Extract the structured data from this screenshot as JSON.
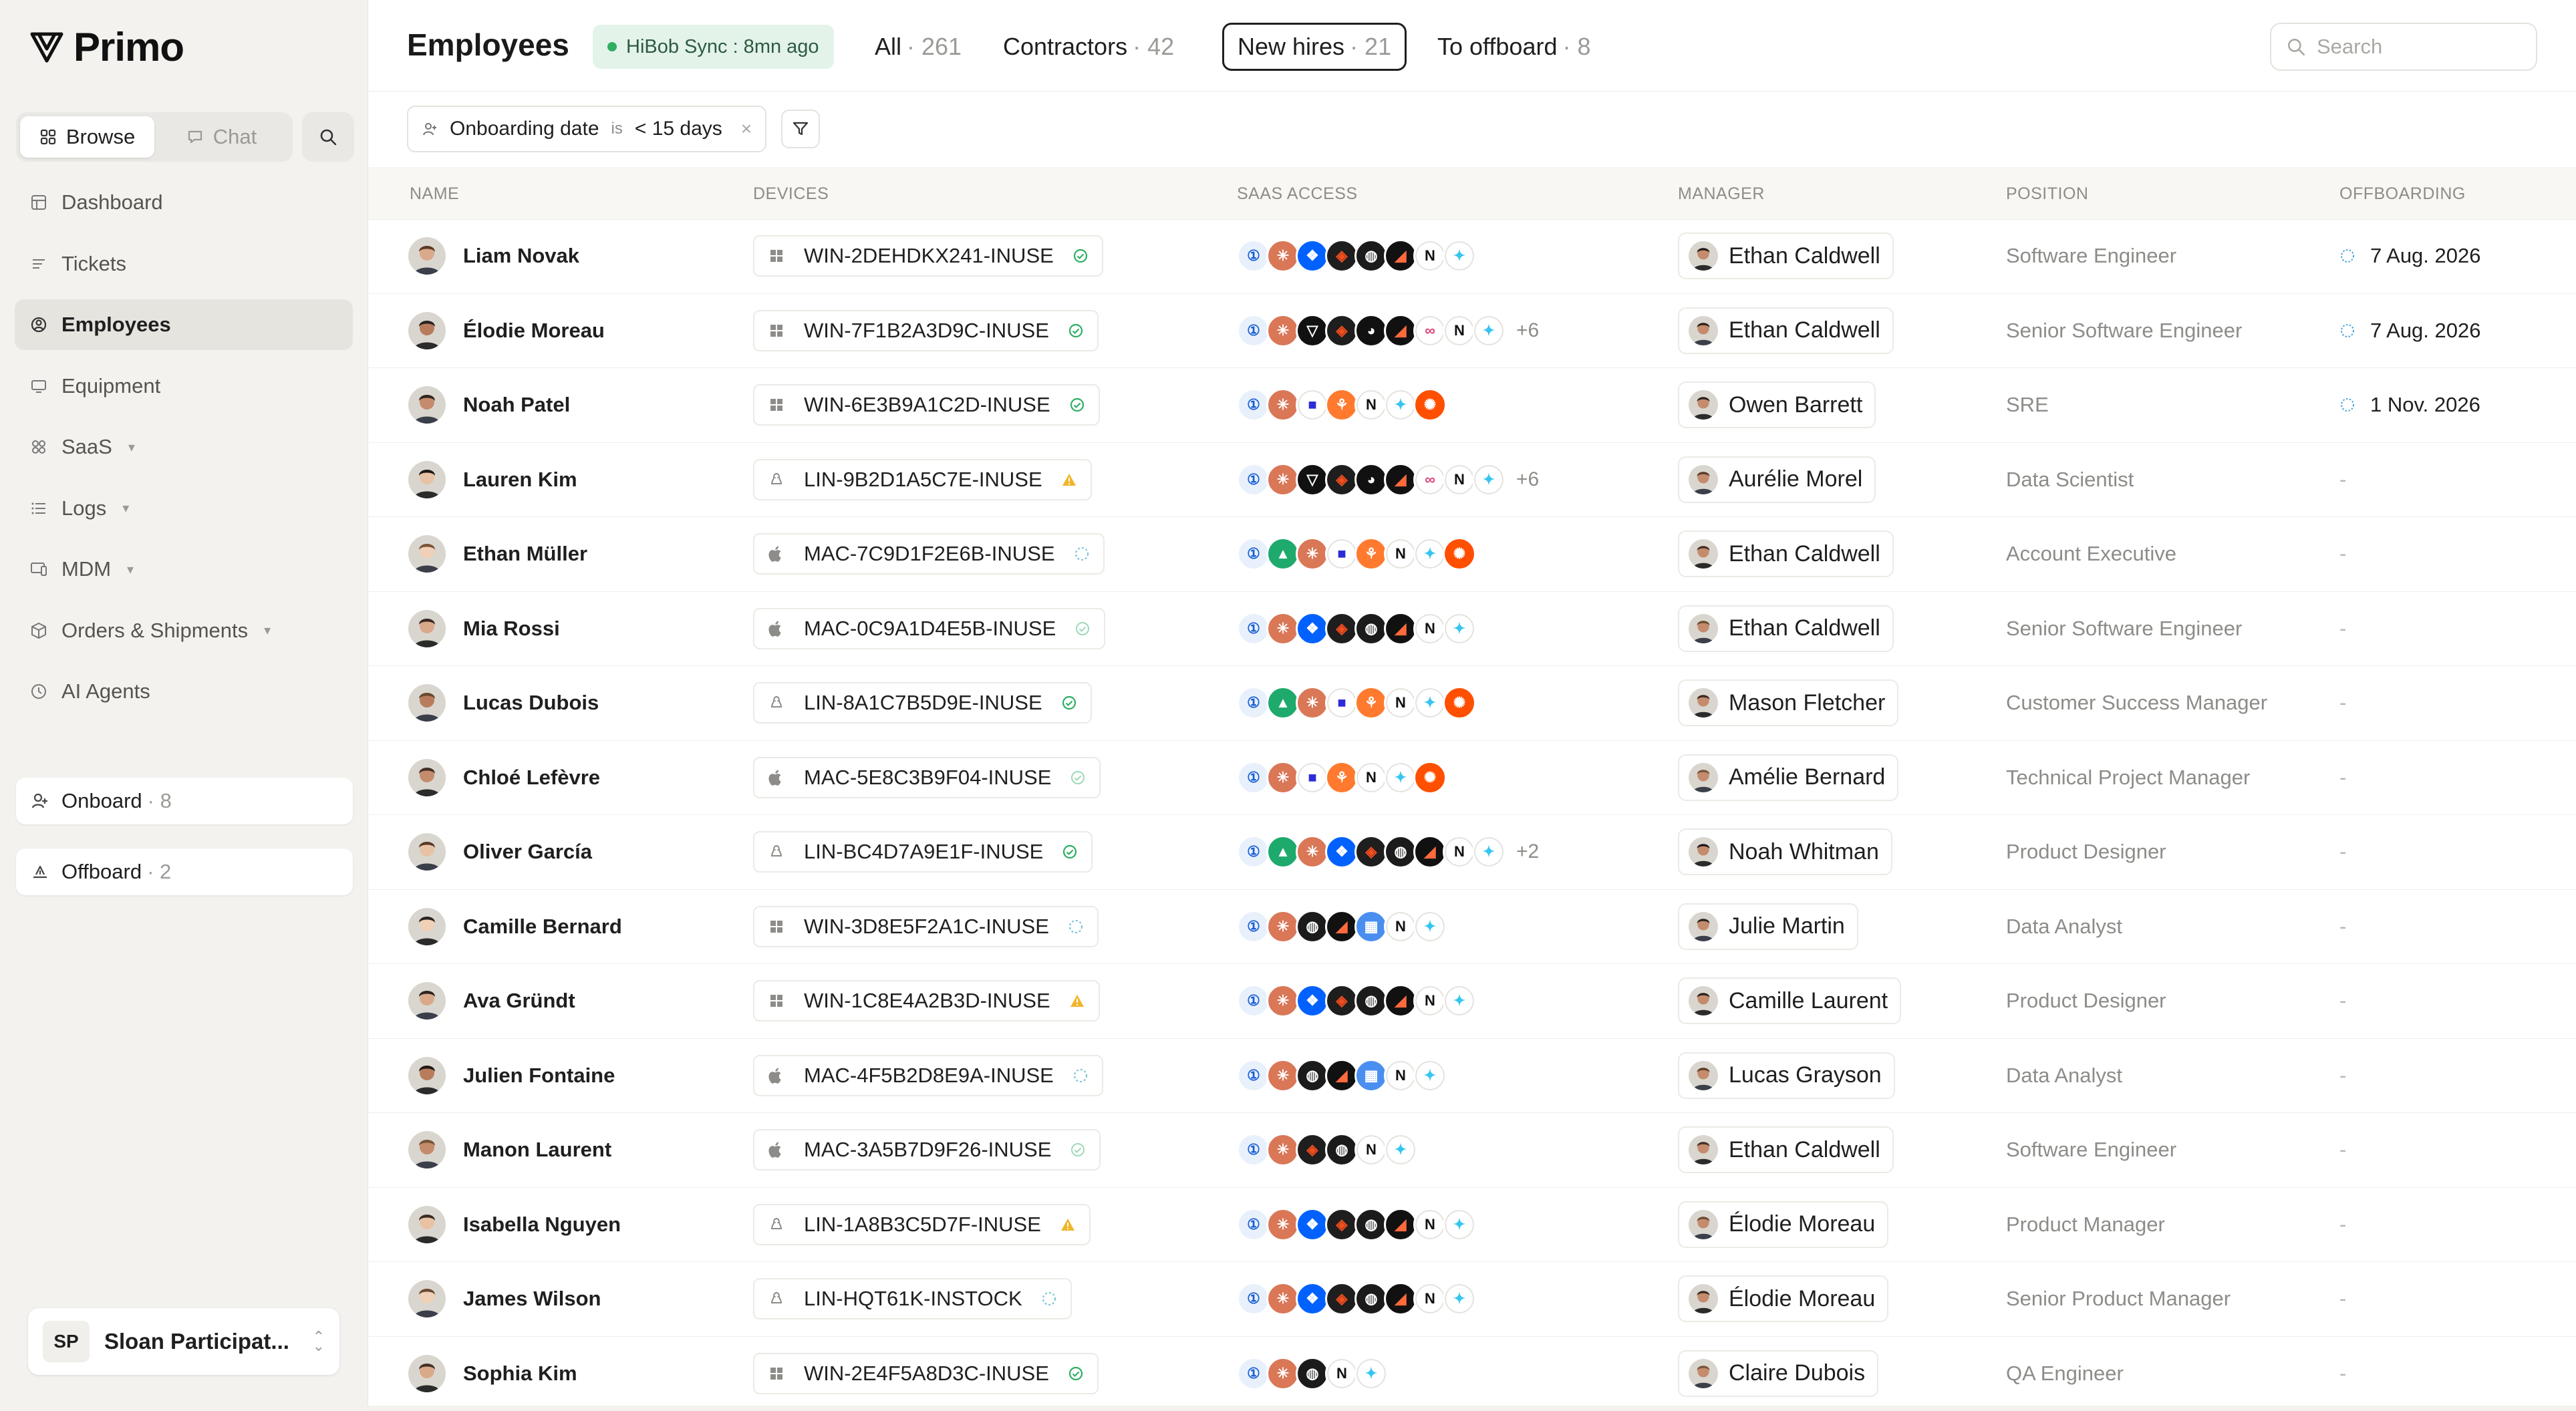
{
  "app": {
    "name": "Primo"
  },
  "sidebar": {
    "modes": [
      {
        "label": "Browse",
        "active": true
      },
      {
        "label": "Chat",
        "active": false
      }
    ],
    "nav": [
      {
        "label": "Dashboard",
        "icon": "dashboard-icon",
        "active": false,
        "caret": false
      },
      {
        "label": "Tickets",
        "icon": "tickets-icon",
        "active": false,
        "caret": false
      },
      {
        "label": "Employees",
        "icon": "employees-icon",
        "active": true,
        "caret": false
      },
      {
        "label": "Equipment",
        "icon": "equipment-icon",
        "active": false,
        "caret": false
      },
      {
        "label": "SaaS",
        "icon": "saas-icon",
        "active": false,
        "caret": true
      },
      {
        "label": "Logs",
        "icon": "logs-icon",
        "active": false,
        "caret": true
      },
      {
        "label": "MDM",
        "icon": "mdm-icon",
        "active": false,
        "caret": true
      },
      {
        "label": "Orders & Shipments",
        "icon": "orders-icon",
        "active": false,
        "caret": true
      },
      {
        "label": "AI Agents",
        "icon": "ai-agents-icon",
        "active": false,
        "caret": false
      }
    ],
    "onboard": {
      "label": "Onboard",
      "count": "· 8"
    },
    "offboard": {
      "label": "Offboard",
      "count": "· 2"
    },
    "workspace": {
      "initials": "SP",
      "name": "Sloan Participat..."
    }
  },
  "header": {
    "title": "Employees",
    "sync": "HiBob Sync : 8mn ago",
    "tabs": [
      {
        "label": "All",
        "count": "· 261",
        "active": false
      },
      {
        "label": "Contractors",
        "count": "· 42",
        "active": false
      },
      {
        "label": "New hires",
        "count": "· 21",
        "active": true
      },
      {
        "label": "To offboard",
        "count": "· 8",
        "active": false
      }
    ],
    "search_placeholder": "Search"
  },
  "filter": {
    "field": "Onboarding date",
    "operator": "is",
    "value": "< 15 days"
  },
  "table": {
    "columns": [
      "Name",
      "Devices",
      "SaaS access",
      "Manager",
      "Position",
      "Offboarding"
    ],
    "rows": [
      {
        "name": "Liam Novak",
        "device": "WIN-2DEHDKX241-INUSE",
        "os": "windows",
        "status": "ok",
        "apps": [
          "1p",
          "claude",
          "dropbox",
          "figma",
          "circle",
          "linear",
          "notion",
          "slack"
        ],
        "more": "",
        "manager": "Ethan Caldwell",
        "position": "Software Engineer",
        "offboarding": "7 Aug. 2026"
      },
      {
        "name": "Élodie Moreau",
        "device": "WIN-7F1B2A3D9C-INUSE",
        "os": "windows",
        "status": "ok",
        "apps": [
          "1p",
          "claude",
          "cursor",
          "figma",
          "github",
          "linear",
          "links",
          "notion",
          "slack"
        ],
        "more": "+6",
        "manager": "Ethan Caldwell",
        "position": "Senior Software Engineer",
        "offboarding": "7 Aug. 2026"
      },
      {
        "name": "Noah Patel",
        "device": "WIN-6E3B9A1C2D-INUSE",
        "os": "windows",
        "status": "ok",
        "apps": [
          "1p",
          "claude",
          "stack",
          "hubspot",
          "notion",
          "slack",
          "zapier"
        ],
        "more": "",
        "manager": "Owen Barrett",
        "position": "SRE",
        "offboarding": "1 Nov. 2026"
      },
      {
        "name": "Lauren Kim",
        "device": "LIN-9B2D1A5C7E-INUSE",
        "os": "linux",
        "status": "warn",
        "apps": [
          "1p",
          "claude",
          "cursor",
          "figma",
          "github",
          "linear",
          "links",
          "notion",
          "slack"
        ],
        "more": "+6",
        "manager": "Aurélie Morel",
        "position": "Data Scientist",
        "offboarding": "-"
      },
      {
        "name": "Ethan Müller",
        "device": "MAC-7C9D1F2E6B-INUSE",
        "os": "mac",
        "status": "pending",
        "apps": [
          "1p",
          "aws",
          "claude",
          "stack",
          "hubspot",
          "notion",
          "slack",
          "zapier"
        ],
        "more": "",
        "manager": "Ethan Caldwell",
        "position": "Account Executive",
        "offboarding": "-"
      },
      {
        "name": "Mia Rossi",
        "device": "MAC-0C9A1D4E5B-INUSE",
        "os": "mac",
        "status": "ok-light",
        "apps": [
          "1p",
          "claude",
          "dropbox",
          "figma",
          "circle",
          "linear",
          "notion",
          "slack"
        ],
        "more": "",
        "manager": "Ethan Caldwell",
        "position": "Senior Software Engineer",
        "offboarding": "-"
      },
      {
        "name": "Lucas Dubois",
        "device": "LIN-8A1C7B5D9E-INUSE",
        "os": "linux",
        "status": "ok",
        "apps": [
          "1p",
          "aws",
          "claude",
          "stack",
          "hubspot",
          "notion",
          "slack",
          "zapier"
        ],
        "more": "",
        "manager": "Mason Fletcher",
        "position": "Customer Success Manager",
        "offboarding": "-"
      },
      {
        "name": "Chloé Lefèvre",
        "device": "MAC-5E8C3B9F04-INUSE",
        "os": "mac",
        "status": "ok-light",
        "apps": [
          "1p",
          "claude",
          "stack",
          "hubspot",
          "notion",
          "slack",
          "zapier"
        ],
        "more": "",
        "manager": "Amélie Bernard",
        "position": "Technical Project Manager",
        "offboarding": "-"
      },
      {
        "name": "Oliver García",
        "device": "LIN-BC4D7A9E1F-INUSE",
        "os": "linux",
        "status": "ok",
        "apps": [
          "1p",
          "aws",
          "claude",
          "dropbox",
          "figma",
          "circle",
          "linear",
          "notion",
          "slack"
        ],
        "more": "+2",
        "manager": "Noah Whitman",
        "position": "Product Designer",
        "offboarding": "-"
      },
      {
        "name": "Camille Bernard",
        "device": "WIN-3D8E5F2A1C-INUSE",
        "os": "windows",
        "status": "pending",
        "apps": [
          "1p",
          "claude",
          "circle",
          "linear",
          "miro",
          "notion",
          "slack"
        ],
        "more": "",
        "manager": "Julie Martin",
        "position": "Data Analyst",
        "offboarding": "-"
      },
      {
        "name": "Ava Gründt",
        "device": "WIN-1C8E4A2B3D-INUSE",
        "os": "windows",
        "status": "warn",
        "apps": [
          "1p",
          "claude",
          "dropbox",
          "figma",
          "circle",
          "linear",
          "notion",
          "slack"
        ],
        "more": "",
        "manager": "Camille Laurent",
        "position": "Product Designer",
        "offboarding": "-"
      },
      {
        "name": "Julien Fontaine",
        "device": "MAC-4F5B2D8E9A-INUSE",
        "os": "mac",
        "status": "pending",
        "apps": [
          "1p",
          "claude",
          "circle",
          "linear",
          "miro",
          "notion",
          "slack"
        ],
        "more": "",
        "manager": "Lucas Grayson",
        "position": "Data Analyst",
        "offboarding": "-"
      },
      {
        "name": "Manon Laurent",
        "device": "MAC-3A5B7D9F26-INUSE",
        "os": "mac",
        "status": "ok-light",
        "apps": [
          "1p",
          "claude",
          "figma",
          "circle",
          "notion",
          "slack"
        ],
        "more": "",
        "manager": "Ethan Caldwell",
        "position": "Software Engineer",
        "offboarding": "-"
      },
      {
        "name": "Isabella Nguyen",
        "device": "LIN-1A8B3C5D7F-INUSE",
        "os": "linux",
        "status": "warn",
        "apps": [
          "1p",
          "claude",
          "dropbox",
          "figma",
          "circle",
          "linear",
          "notion",
          "slack"
        ],
        "more": "",
        "manager": "Élodie Moreau",
        "position": "Product Manager",
        "offboarding": "-"
      },
      {
        "name": "James Wilson",
        "device": "LIN-HQT61K-INSTOCK",
        "os": "linux",
        "status": "pending",
        "apps": [
          "1p",
          "claude",
          "dropbox",
          "figma",
          "circle",
          "linear",
          "notion",
          "slack"
        ],
        "more": "",
        "manager": "Élodie Moreau",
        "position": "Senior Product Manager",
        "offboarding": "-"
      },
      {
        "name": "Sophia Kim",
        "device": "WIN-2E4F5A8D3C-INUSE",
        "os": "windows",
        "status": "ok",
        "apps": [
          "1p",
          "claude",
          "circle",
          "notion",
          "slack"
        ],
        "more": "",
        "manager": "Claire Dubois",
        "position": "QA Engineer",
        "offboarding": "-"
      }
    ]
  },
  "colors": {
    "accent_green": "#2fae64",
    "warning": "#e8a317",
    "sync_bg": "#e3f3ea",
    "muted_text": "#8d8c88"
  },
  "app_icons": {
    "1p": {
      "bg": "#e8f0fb",
      "fg": "#1a5fd4",
      "glyph": "①",
      "name": "1password-icon"
    },
    "claude": {
      "bg": "#d97757",
      "fg": "#ffffff",
      "glyph": "✳",
      "name": "claude-icon"
    },
    "dropbox": {
      "bg": "#0061fe",
      "fg": "#ffffff",
      "glyph": "❖",
      "name": "dropbox-icon"
    },
    "figma": {
      "bg": "#1e1e1e",
      "fg": "#f24e1e",
      "glyph": "◈",
      "name": "figma-icon"
    },
    "cursor": {
      "bg": "#111111",
      "fg": "#ffffff",
      "glyph": "▽",
      "name": "cursor-icon"
    },
    "github": {
      "bg": "#111111",
      "fg": "#ffffff",
      "glyph": "◕",
      "name": "github-icon"
    },
    "circle": {
      "bg": "#1b1b1b",
      "fg": "#ffffff",
      "glyph": "◍",
      "name": "circle-icon"
    },
    "linear": {
      "bg": "#111111",
      "fg": "#ff6a3d",
      "glyph": "◢",
      "name": "linear-icon"
    },
    "links": {
      "bg": "#ffffff",
      "fg": "#e0447a",
      "glyph": "∞",
      "name": "links-icon"
    },
    "notion": {
      "bg": "#ffffff",
      "fg": "#111111",
      "glyph": "N",
      "name": "notion-icon"
    },
    "slack": {
      "bg": "#ffffff",
      "fg": "#36c5f0",
      "glyph": "✦",
      "name": "slack-icon"
    },
    "stack": {
      "bg": "#ffffff",
      "fg": "#2d2bd7",
      "glyph": "■",
      "name": "stack-icon"
    },
    "hubspot": {
      "bg": "#ff7a2f",
      "fg": "#ffffff",
      "glyph": "⚘",
      "name": "hubspot-icon"
    },
    "zapier": {
      "bg": "#ff4f00",
      "fg": "#ffffff",
      "glyph": "✺",
      "name": "zapier-icon"
    },
    "aws": {
      "bg": "#1eaa6d",
      "fg": "#ffffff",
      "glyph": "▲",
      "name": "aws-icon"
    },
    "miro": {
      "bg": "#4a8ff0",
      "fg": "#ffffff",
      "glyph": "▦",
      "name": "miro-icon"
    }
  }
}
